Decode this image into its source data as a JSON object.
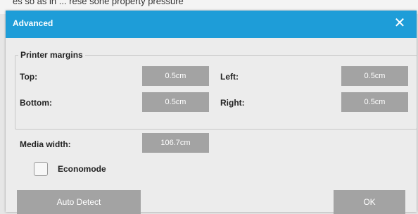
{
  "background_caption": "es so as in ... rese sone property pressure",
  "dialog": {
    "title": "Advanced",
    "close_glyph": "✕",
    "colors": {
      "titlebar": "#1e9dd8",
      "field": "#a3a3a3",
      "dialog_bg": "#ececec"
    }
  },
  "printer_margins": {
    "group_label": "Printer margins",
    "top_label": "Top:",
    "top_value": "0.5cm",
    "left_label": "Left:",
    "left_value": "0.5cm",
    "bottom_label": "Bottom:",
    "bottom_value": "0.5cm",
    "right_label": "Right:",
    "right_value": "0.5cm"
  },
  "media": {
    "width_label": "Media width:",
    "width_value": "106.7cm"
  },
  "economode": {
    "label": "Economode",
    "checked": false
  },
  "buttons": {
    "auto_detect": "Auto Detect",
    "ok": "OK"
  }
}
